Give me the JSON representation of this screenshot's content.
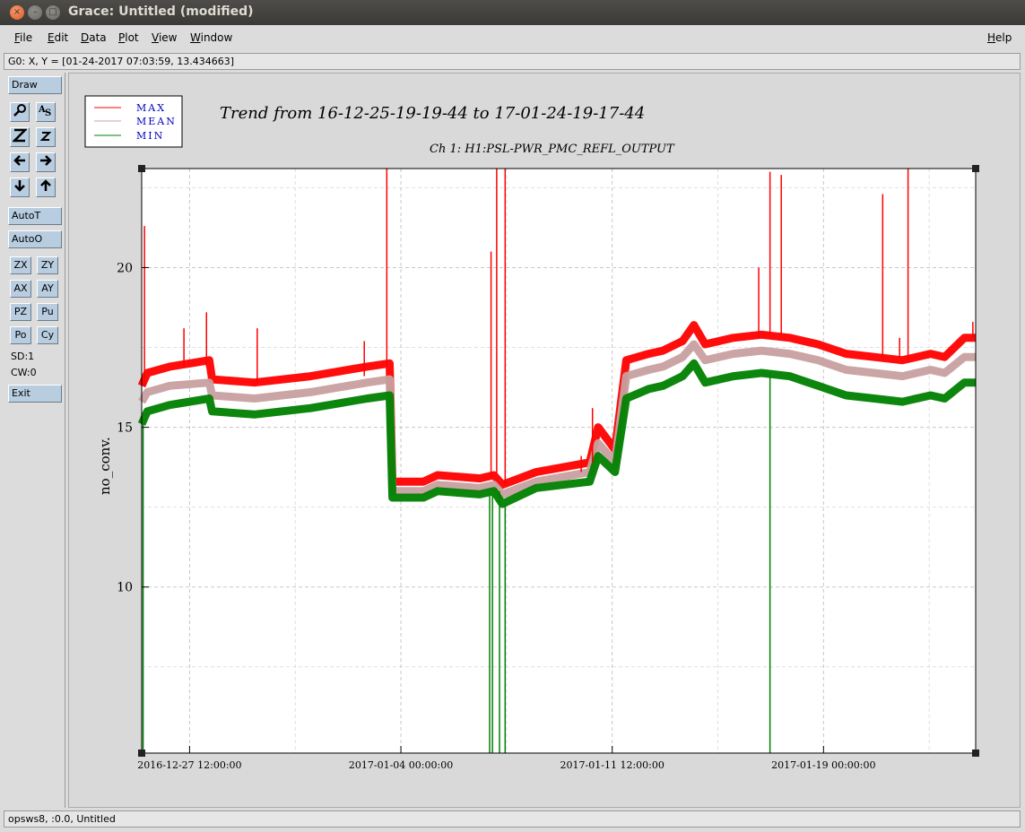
{
  "window": {
    "title": "Grace: Untitled (modified)",
    "close_glyph": "×",
    "min_glyph": "–",
    "max_glyph": "□"
  },
  "menu": {
    "file": "File",
    "edit": "Edit",
    "data": "Data",
    "plot": "Plot",
    "view": "View",
    "window": "Window",
    "help": "Help"
  },
  "locator": "G0: X, Y = [01-24-2017 07:03:59, 13.434663]",
  "toolbar": {
    "draw": "Draw",
    "autot": "AutoT",
    "autoo": "AutoO",
    "zx": "ZX",
    "zy": "ZY",
    "ax": "AX",
    "ay": "AY",
    "pz": "PZ",
    "pu": "Pu",
    "po": "Po",
    "cy": "Cy",
    "sd": "SD:1",
    "cw": "CW:0",
    "exit": "Exit",
    "icons": {
      "zoom": "magnifier-icon",
      "autoscale_text": "text-icon",
      "zoom_in": "zoom-in-z-icon",
      "zoom_out": "zoom-out-z-icon",
      "left": "arrow-left-icon",
      "right": "arrow-right-icon",
      "down": "arrow-down-icon",
      "up": "arrow-up-icon"
    }
  },
  "statusbar": "opsws8, :0.0, Untitled",
  "colors": {
    "max": "#ff0000",
    "mean": "#c8a0a0",
    "min": "#008000",
    "legend_text": "#0000c0"
  },
  "chart_data": {
    "type": "line",
    "title": "Trend from 16-12-25-19-19-44 to 17-01-24-19-17-44",
    "subtitle": "Ch 1: H1:PSL-PWR_PMC_REFL_OUTPUT",
    "xlabel": "",
    "ylabel": "no_conv.",
    "xlim": [
      0,
      29.6
    ],
    "ylim": [
      4.8,
      23.1
    ],
    "yticks": [
      10,
      15,
      20
    ],
    "xtick_labels": [
      {
        "x": 1.7,
        "label": "2016-12-27 12:00:00"
      },
      {
        "x": 9.2,
        "label": "2017-01-04 00:00:00"
      },
      {
        "x": 16.7,
        "label": "2017-01-11 12:00:00"
      },
      {
        "x": 24.2,
        "label": "2017-01-19 00:00:00"
      }
    ],
    "grid": true,
    "legend": "top-left",
    "x": [
      0,
      0.2,
      1.0,
      2.4,
      2.5,
      4.0,
      6.0,
      8.0,
      8.8,
      8.9,
      10.0,
      10.5,
      12.0,
      12.5,
      12.8,
      14.0,
      15.9,
      16.2,
      16.8,
      17.2,
      18.0,
      18.5,
      19.2,
      19.6,
      20.0,
      21.0,
      22.0,
      23.0,
      24.0,
      25.0,
      26.0,
      27.0,
      28.0,
      28.5,
      29.2,
      29.6
    ],
    "series": [
      {
        "name": "MAX",
        "values": [
          16.3,
          16.7,
          16.9,
          17.1,
          16.5,
          16.4,
          16.6,
          16.9,
          17.0,
          13.3,
          13.3,
          13.5,
          13.4,
          13.5,
          13.2,
          13.6,
          13.9,
          15.0,
          14.3,
          17.1,
          17.3,
          17.4,
          17.7,
          18.2,
          17.6,
          17.8,
          17.9,
          17.8,
          17.6,
          17.3,
          17.2,
          17.1,
          17.3,
          17.2,
          17.8,
          17.8
        ]
      },
      {
        "name": "MEAN",
        "values": [
          15.8,
          16.1,
          16.3,
          16.4,
          16.0,
          15.9,
          16.1,
          16.4,
          16.5,
          13.0,
          13.0,
          13.2,
          13.1,
          13.2,
          12.9,
          13.3,
          13.6,
          14.5,
          13.9,
          16.6,
          16.8,
          16.9,
          17.2,
          17.6,
          17.1,
          17.3,
          17.4,
          17.3,
          17.1,
          16.8,
          16.7,
          16.6,
          16.8,
          16.7,
          17.2,
          17.2
        ]
      },
      {
        "name": "MIN",
        "values": [
          15.1,
          15.5,
          15.7,
          15.9,
          15.5,
          15.4,
          15.6,
          15.9,
          16.0,
          12.8,
          12.8,
          13.0,
          12.9,
          13.0,
          12.6,
          13.1,
          13.3,
          14.1,
          13.6,
          15.9,
          16.2,
          16.3,
          16.6,
          17.0,
          16.4,
          16.6,
          16.7,
          16.6,
          16.3,
          16.0,
          15.9,
          15.8,
          16.0,
          15.9,
          16.4,
          16.4
        ]
      }
    ],
    "spikes": [
      {
        "series": "MAX",
        "x": 0.1,
        "value": 21.3
      },
      {
        "series": "MAX",
        "x": 1.5,
        "value": 18.1
      },
      {
        "series": "MAX",
        "x": 2.3,
        "value": 18.6
      },
      {
        "series": "MAX",
        "x": 4.1,
        "value": 18.1
      },
      {
        "series": "MAX",
        "x": 7.9,
        "value": 17.7
      },
      {
        "series": "MAX",
        "x": 8.7,
        "value": 23.1
      },
      {
        "series": "MAX",
        "x": 12.4,
        "value": 20.5
      },
      {
        "series": "MAX",
        "x": 12.6,
        "value": 23.1
      },
      {
        "series": "MAX",
        "x": 12.9,
        "value": 23.1
      },
      {
        "series": "MAX",
        "x": 15.6,
        "value": 14.1
      },
      {
        "series": "MAX",
        "x": 16.0,
        "value": 15.6
      },
      {
        "series": "MAX",
        "x": 21.9,
        "value": 20.0
      },
      {
        "series": "MAX",
        "x": 22.3,
        "value": 23.0
      },
      {
        "series": "MAX",
        "x": 22.7,
        "value": 22.9
      },
      {
        "series": "MAX",
        "x": 26.3,
        "value": 22.3
      },
      {
        "series": "MAX",
        "x": 26.9,
        "value": 17.8
      },
      {
        "series": "MAX",
        "x": 27.2,
        "value": 23.1
      },
      {
        "series": "MAX",
        "x": 29.5,
        "value": 18.3
      },
      {
        "series": "MIN",
        "x": 0.05,
        "value": 4.8
      },
      {
        "series": "MIN",
        "x": 12.35,
        "value": 4.8
      },
      {
        "series": "MIN",
        "x": 12.45,
        "value": 4.8
      },
      {
        "series": "MIN",
        "x": 12.7,
        "value": 4.8
      },
      {
        "series": "MIN",
        "x": 12.9,
        "value": 4.8
      },
      {
        "series": "MIN",
        "x": 22.3,
        "value": 4.8
      }
    ]
  }
}
